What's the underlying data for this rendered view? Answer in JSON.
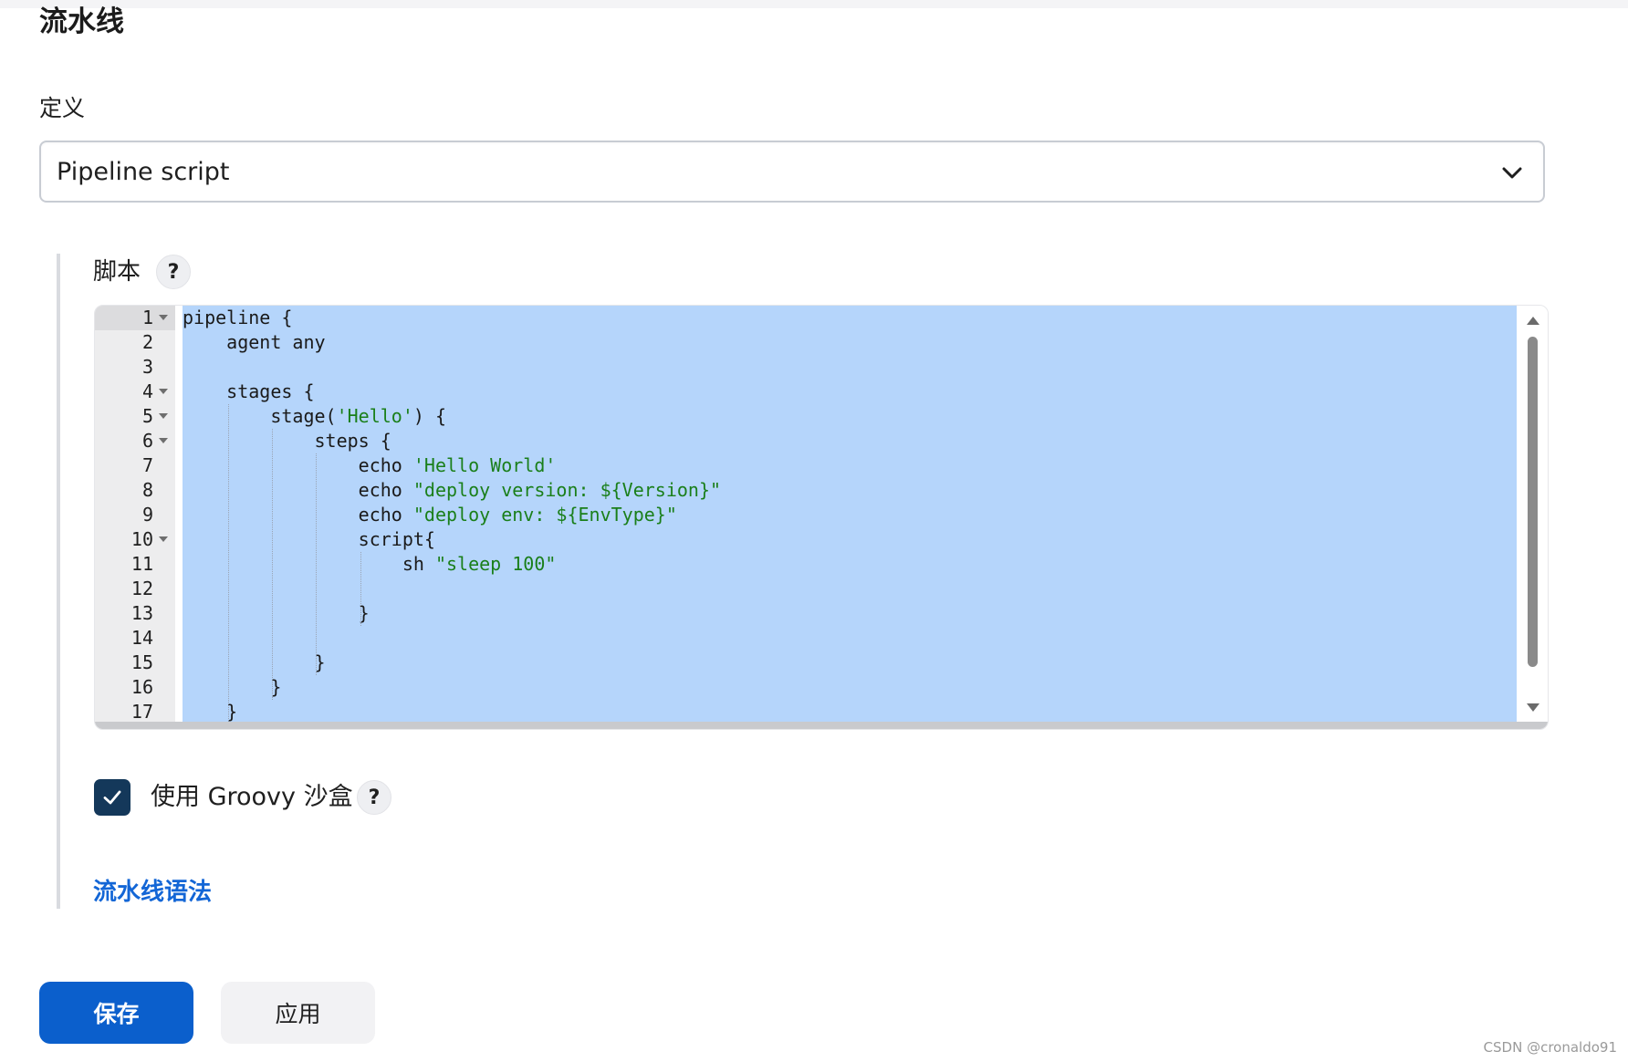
{
  "section_title": "流水线",
  "definition": {
    "label": "定义",
    "selected": "Pipeline script"
  },
  "script": {
    "label": "脚本",
    "help": "?"
  },
  "editor": {
    "lines": [
      {
        "n": "1",
        "fold": true,
        "code": [
          {
            "t": "pipeline {"
          }
        ]
      },
      {
        "n": "2",
        "fold": false,
        "code": [
          {
            "t": "    agent any"
          }
        ]
      },
      {
        "n": "3",
        "fold": false,
        "code": []
      },
      {
        "n": "4",
        "fold": true,
        "code": [
          {
            "t": "    stages {"
          }
        ]
      },
      {
        "n": "5",
        "fold": true,
        "code": [
          {
            "t": "        stage("
          },
          {
            "t": "'Hello'",
            "s": true
          },
          {
            "t": ") {"
          }
        ]
      },
      {
        "n": "6",
        "fold": true,
        "code": [
          {
            "t": "            steps {"
          }
        ]
      },
      {
        "n": "7",
        "fold": false,
        "code": [
          {
            "t": "                echo "
          },
          {
            "t": "'Hello World'",
            "s": true
          }
        ]
      },
      {
        "n": "8",
        "fold": false,
        "code": [
          {
            "t": "                echo "
          },
          {
            "t": "\"deploy version: ${Version}\"",
            "s": true
          }
        ]
      },
      {
        "n": "9",
        "fold": false,
        "code": [
          {
            "t": "                echo "
          },
          {
            "t": "\"deploy env: ${EnvType}\"",
            "s": true
          }
        ]
      },
      {
        "n": "10",
        "fold": true,
        "code": [
          {
            "t": "                script{"
          }
        ]
      },
      {
        "n": "11",
        "fold": false,
        "code": [
          {
            "t": "                    sh "
          },
          {
            "t": "\"sleep 100\"",
            "s": true
          }
        ]
      },
      {
        "n": "12",
        "fold": false,
        "code": []
      },
      {
        "n": "13",
        "fold": false,
        "code": [
          {
            "t": "                }"
          }
        ]
      },
      {
        "n": "14",
        "fold": false,
        "code": []
      },
      {
        "n": "15",
        "fold": false,
        "code": [
          {
            "t": "            }"
          }
        ]
      },
      {
        "n": "16",
        "fold": false,
        "code": [
          {
            "t": "        }"
          }
        ]
      },
      {
        "n": "17",
        "fold": false,
        "code": [
          {
            "t": "    }"
          }
        ]
      }
    ]
  },
  "sandbox": {
    "label": "使用 Groovy 沙盒",
    "checked": true,
    "help": "?"
  },
  "syntax_link": "流水线语法",
  "buttons": {
    "save": "保存",
    "apply": "应用"
  },
  "watermark": "CSDN @cronaldo91",
  "colors": {
    "primary": "#0b5fcc",
    "link": "#1366d6",
    "selection": "#b5d5fb",
    "string": "#1a7f1a",
    "checkbox": "#14385a"
  }
}
